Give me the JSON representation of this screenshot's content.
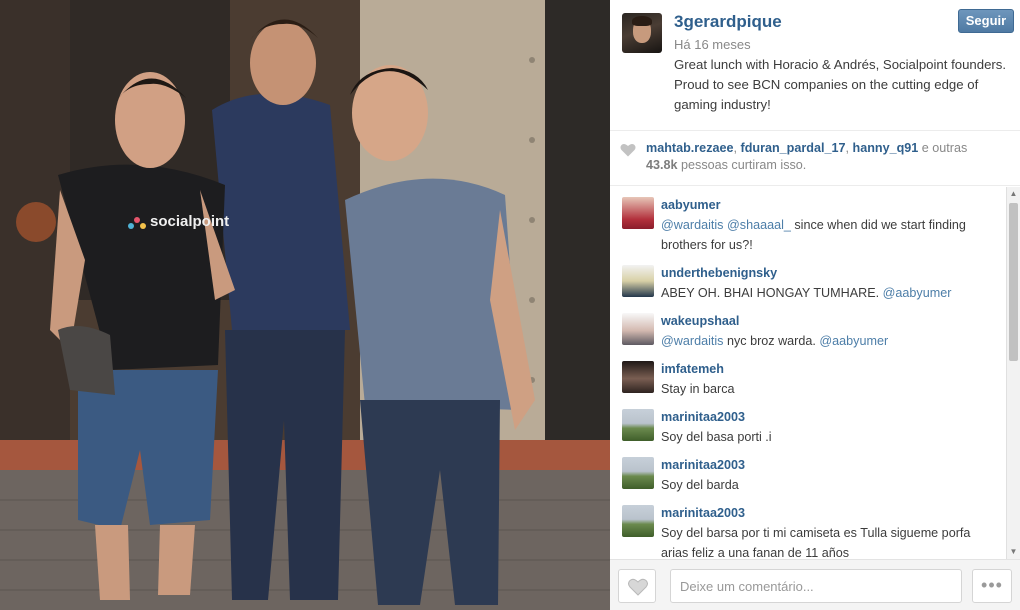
{
  "post": {
    "author": "3gerardpique",
    "time_ago": "Há 16 meses",
    "caption": "Great lunch with Horacio & Andrés, Socialpoint founders. Proud to see BCN companies on the cutting edge of gaming industry!",
    "follow_label": "Seguir",
    "photo": {
      "shirt_logo_text": "socialpoint"
    }
  },
  "likes": {
    "users": [
      "mahtab.rezaee",
      "fduran_pardal_17",
      "hanny_q91"
    ],
    "separator": ",",
    "others_text": "e outras",
    "count": "43.8k",
    "suffix": "pessoas curtiram isso."
  },
  "comments": [
    {
      "user": "aabyumer",
      "parts": [
        {
          "t": "@wardaitis",
          "m": true
        },
        {
          "t": " "
        },
        {
          "t": "@shaaaal_",
          "m": true
        },
        {
          "t": " since when did we start finding brothers for us?!"
        }
      ],
      "avatar": "av-aaby"
    },
    {
      "user": "underthebenignsky",
      "parts": [
        {
          "t": "ABEY OH. BHAI HONGAY TUMHARE. "
        },
        {
          "t": "@aabyumer",
          "m": true
        }
      ],
      "avatar": "av-under"
    },
    {
      "user": "wakeupshaal",
      "parts": [
        {
          "t": "@wardaitis",
          "m": true
        },
        {
          "t": " nyc broz warda. "
        },
        {
          "t": "@aabyumer",
          "m": true
        }
      ],
      "avatar": "av-wake"
    },
    {
      "user": "imfatemeh",
      "parts": [
        {
          "t": "Stay in barca"
        }
      ],
      "avatar": "av-imf"
    },
    {
      "user": "marinitaa2003",
      "parts": [
        {
          "t": "Soy del basa porti .i"
        }
      ],
      "avatar": "av-mar"
    },
    {
      "user": "marinitaa2003",
      "parts": [
        {
          "t": "Soy del barda"
        }
      ],
      "avatar": "av-mar"
    },
    {
      "user": "marinitaa2003",
      "parts": [
        {
          "t": "Soy del barsa por ti mi camiseta es Tulla sigueme porfa arias feliz a una fanan de 11 años"
        }
      ],
      "avatar": "av-mar"
    }
  ],
  "footer": {
    "comment_placeholder": "Deixe um comentário...",
    "more_label": "•••"
  },
  "icons": {
    "likes_heart": "heart-icon",
    "like_button": "heart-outline-icon",
    "more": "ellipsis-icon",
    "scroll_up": "arrow-up-icon",
    "scroll_down": "arrow-down-icon"
  },
  "colors": {
    "link": "#2f5f8c",
    "mention": "#4d7ea8",
    "follow_button": "#517ba5"
  }
}
